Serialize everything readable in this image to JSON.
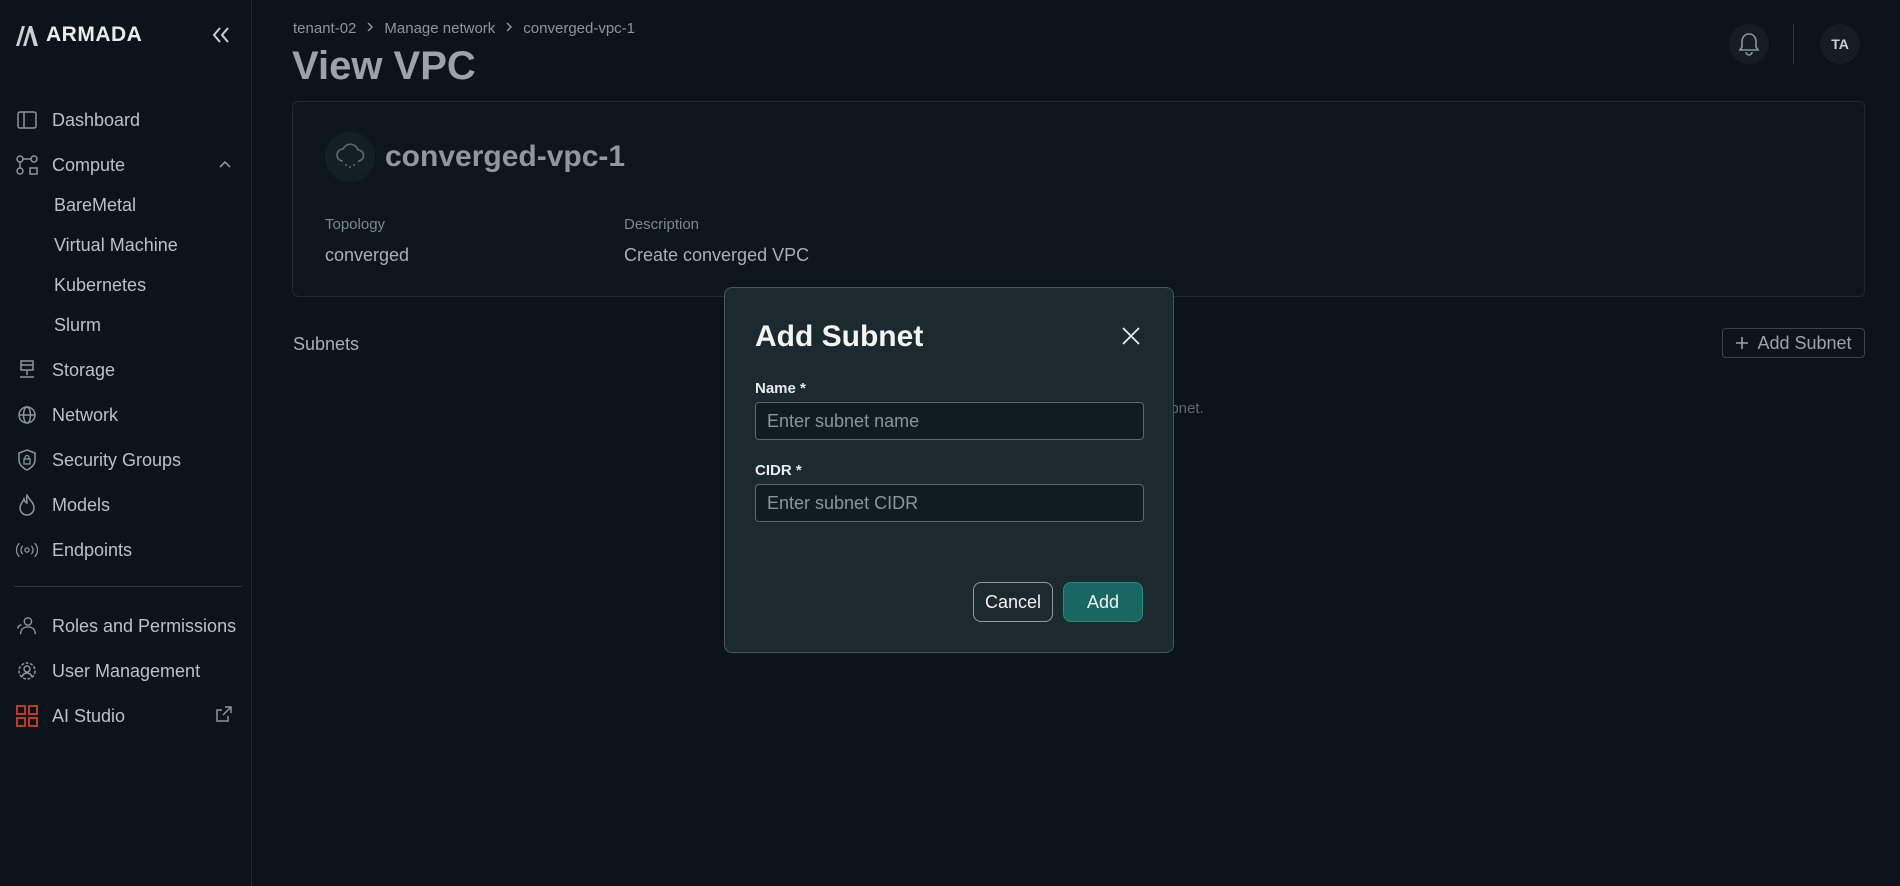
{
  "app": {
    "brand": "ARMADA"
  },
  "sidebar": {
    "items": [
      {
        "label": "Dashboard",
        "icon": "dashboard-icon"
      },
      {
        "label": "Compute",
        "icon": "compute-icon"
      },
      {
        "label": "BareMetal"
      },
      {
        "label": "Virtual Machine"
      },
      {
        "label": "Kubernetes"
      },
      {
        "label": "Slurm"
      },
      {
        "label": "Storage",
        "icon": "storage-icon"
      },
      {
        "label": "Network",
        "icon": "globe-icon"
      },
      {
        "label": "Security Groups",
        "icon": "shield-icon"
      },
      {
        "label": "Models",
        "icon": "flame-icon"
      },
      {
        "label": "Endpoints",
        "icon": "broadcast-icon"
      },
      {
        "label": "Roles and Permissions",
        "icon": "users-icon"
      },
      {
        "label": "User Management",
        "icon": "user-gear-icon"
      },
      {
        "label": "AI Studio",
        "icon": "grid-icon"
      }
    ]
  },
  "header": {
    "breadcrumb": [
      "tenant-02",
      "Manage network",
      "converged-vpc-1"
    ],
    "title": "View VPC",
    "avatar_initials": "TA"
  },
  "vpc": {
    "name": "converged-vpc-1",
    "topology_label": "Topology",
    "topology_value": "converged",
    "description_label": "Description",
    "description_value": "Create converged VPC"
  },
  "subnets": {
    "title": "Subnets",
    "add_label": "Add Subnet",
    "empty_text": "ubnet."
  },
  "modal": {
    "title": "Add Subnet",
    "name_label": "Name *",
    "name_value": "",
    "name_placeholder": "Enter subnet name",
    "cidr_label": "CIDR *",
    "cidr_value": "",
    "cidr_placeholder": "Enter subnet CIDR",
    "cancel_label": "Cancel",
    "add_label": "Add"
  },
  "colors": {
    "background": "#0b1418",
    "modal_bg": "#1c292e",
    "primary_button": "#186761",
    "ai_studio_icon": "#c0392b"
  }
}
